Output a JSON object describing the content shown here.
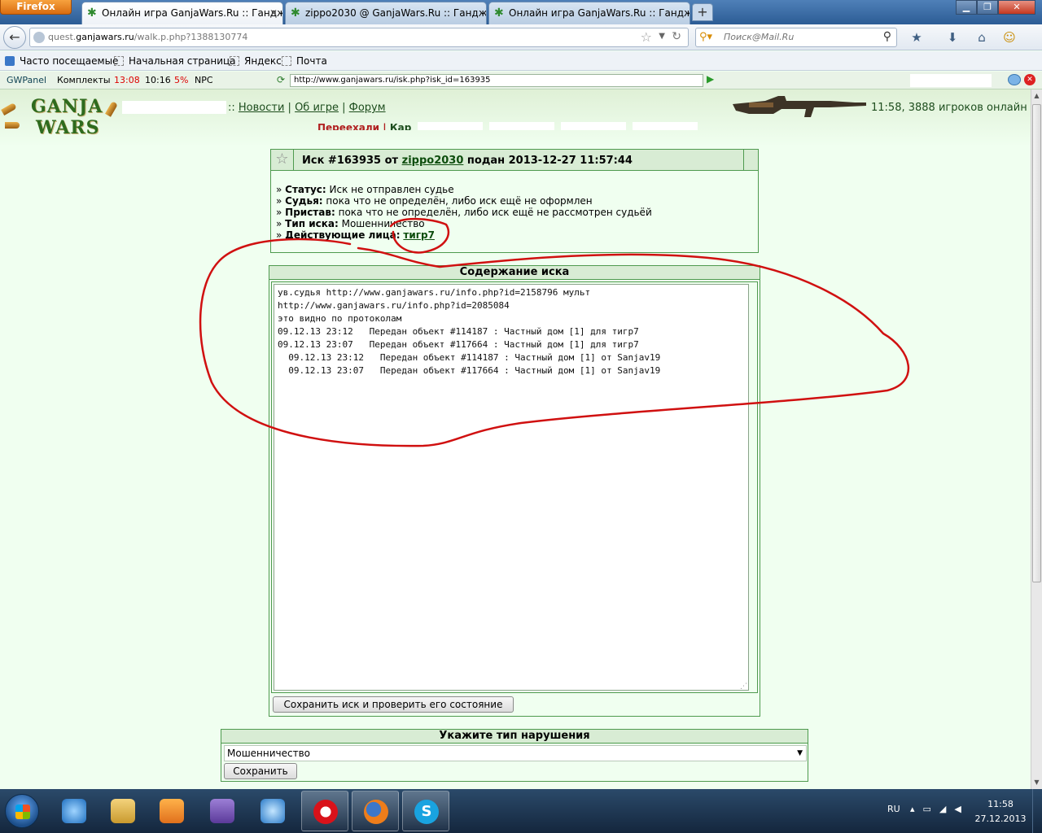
{
  "browser": {
    "menu_button": "Firefox",
    "tabs": [
      {
        "label": "Онлайн игра GanjaWars.Ru :: Гандж...",
        "active": true
      },
      {
        "label": "zippo2030 @ GanjaWars.Ru :: Ганджу...",
        "active": false
      },
      {
        "label": "Онлайн игра GanjaWars.Ru :: Гандж...",
        "active": false
      }
    ],
    "new_tab": "+",
    "url_domain_prefix": "quest.",
    "url_domain": "ganjawars.ru",
    "url_path": "/walk.p.php?1388130774",
    "search_placeholder": "Поиск@Mail.Ru"
  },
  "bookmarks": [
    "Часто посещаемые",
    "Начальная страница",
    "Яндекс",
    "Почта"
  ],
  "gwpanel": {
    "title": "GWPanel",
    "kits": "Комплекты",
    "time1": "13:08",
    "time2": "10:16",
    "percent": "5%",
    "npc": "NPC",
    "url": "http://www.ganjawars.ru/isk.php?isk_id=163935"
  },
  "site": {
    "logo_top": "GANJA",
    "logo_bottom": "WARS",
    "nav_sep": "::",
    "nav": [
      "Новости",
      "Об игре",
      "Форум"
    ],
    "subnav_first": "Переехали",
    "subnav_second": "Кар",
    "online": "11:58, 3888 игроков онлайн"
  },
  "case": {
    "title_prefix": "Иск #163935 от",
    "plaintiff": "zippo2030",
    "title_suffix": "подан 2013-12-27 11:57:44",
    "rows": [
      {
        "label": "Статус:",
        "value": "Иск не отправлен судье"
      },
      {
        "label": "Судья:",
        "value": "пока что не определён, либо иск ещё не оформлен"
      },
      {
        "label": "Пристав:",
        "value": "пока что не определён, либо иск ещё не рассмотрен судьёй"
      },
      {
        "label": "Тип иска:",
        "value": "Мошенничество"
      }
    ],
    "persons_label": "Действующие лица:",
    "person": "тигр7"
  },
  "content": {
    "header": "Содержание иска",
    "text": "ув.судья http://www.ganjawars.ru/info.php?id=2158796 мульт\nhttp://www.ganjawars.ru/info.php?id=2085084\nэто видно по протоколам\n09.12.13 23:12   Передан объект #114187 : Частный дом [1] для тигр7\n09.12.13 23:07   Передан объект #117664 : Частный дом [1] для тигр7\n  09.12.13 23:12   Передан объект #114187 : Частный дом [1] от Sanjav19\n  09.12.13 23:07   Передан объект #117664 : Частный дом [1] от Sanjav19",
    "save_button": "Сохранить иск и проверить его состояние"
  },
  "violation": {
    "header": "Укажите тип нарушения",
    "selected": "Мошенничество",
    "save_button": "Сохранить"
  },
  "taskbar": {
    "lang": "RU",
    "time": "11:58",
    "date": "27.12.2013"
  },
  "colors": {
    "page_bg": "#f0fff0",
    "panel_border": "#4e9a4e",
    "panel_header": "#d8ecd4",
    "annotation": "#d01010"
  }
}
